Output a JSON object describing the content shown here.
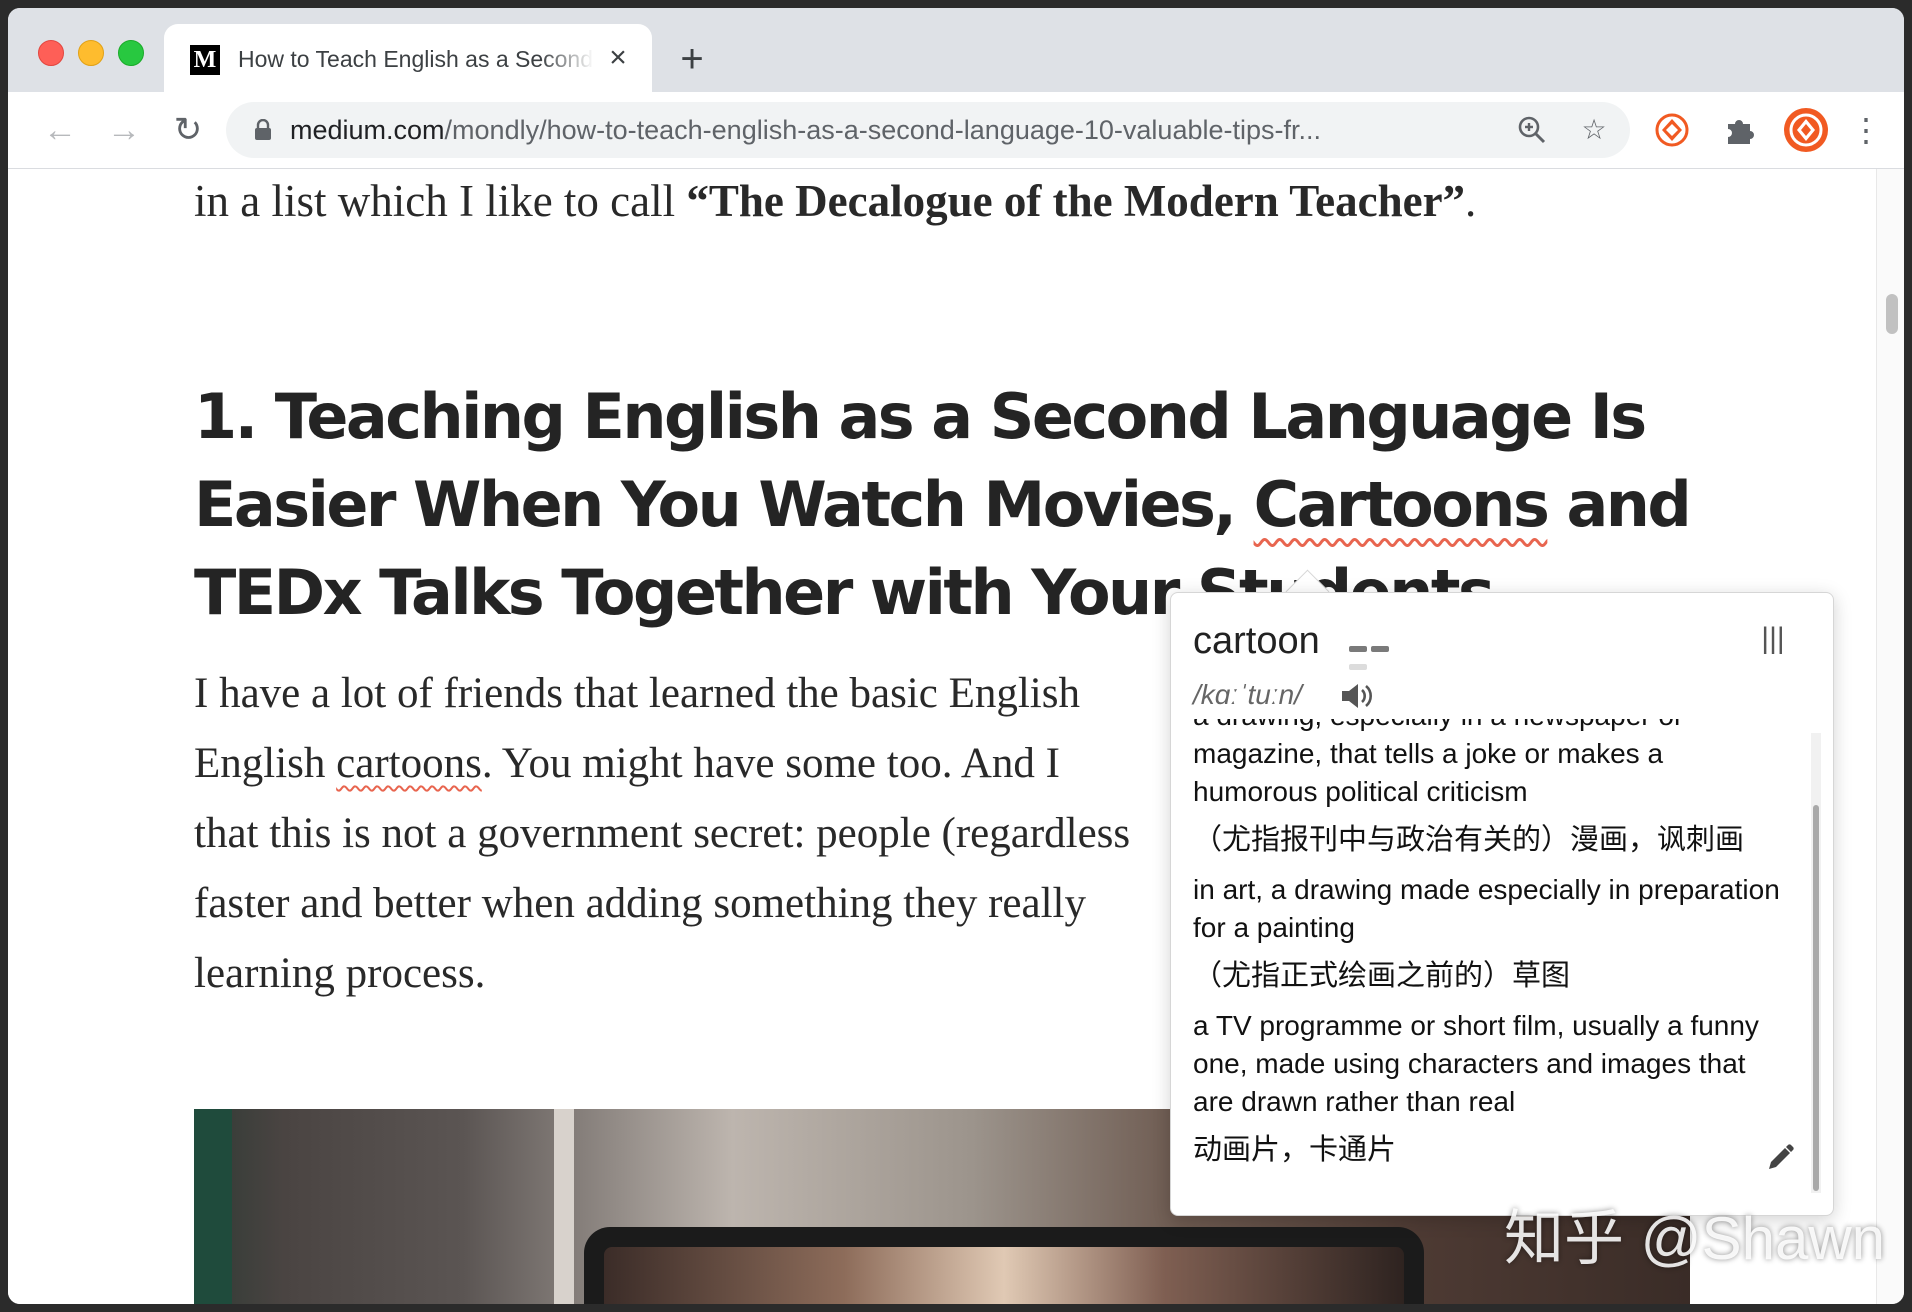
{
  "browser": {
    "tab": {
      "favicon": "M",
      "title": "How to Teach English as a Second Language"
    },
    "new_tab": "+",
    "url_host": "medium.com",
    "url_path": "/mondly/how-to-teach-english-as-a-second-language-10-valuable-tips-fr...",
    "icons": [
      "back-icon",
      "forward-icon",
      "reload-icon",
      "lock-icon",
      "zoom-icon",
      "star-icon",
      "extension-icon",
      "puzzle-icon",
      "profile-icon",
      "menu-icon"
    ]
  },
  "article": {
    "lead_pre": "in a list which I like to call ",
    "lead_bold": "“The Decalogue of the Modern Teacher”",
    "lead_post": ".",
    "heading_line1": "1. Teaching English as a Second Language Is",
    "heading_line2_pre": "Easier When You Watch Movies, ",
    "heading_line2_word": "Cartoons",
    "heading_line2_post": " and",
    "heading_line3": "TEDx Talks Together with Your Students",
    "para_line1": "I have a lot of friends that learned the basic English",
    "para_line2_pre": "English ",
    "para_line2_word": "cartoons",
    "para_line2_post": ". You might have some too. And I",
    "para_line3": "that this is not a government secret: people (regardless",
    "para_line4": "faster and better when adding something they really",
    "para_line5": "learning process."
  },
  "dictionary": {
    "word": "cartoon",
    "phonetic": "/kɑːˈtuːn/",
    "frequency_level": 2,
    "frequency_max": 3,
    "definitions": [
      {
        "en": "a drawing, especially in a newspaper or magazine, that tells a joke or makes a humorous political criticism",
        "zh": "（尤指报刊中与政治有关的）漫画，讽刺画"
      },
      {
        "en": "in art, a drawing made especially in preparation for a painting",
        "zh": "（尤指正式绘画之前的）草图"
      },
      {
        "en": "a TV programme or short film, usually a funny one, made using characters and images that are drawn rather than real",
        "zh": "动画片，卡通片"
      }
    ]
  },
  "watermark": "知乎 @Shawn",
  "colors": {
    "accent_profile": "#f15a22",
    "squiggle": "#e8654f",
    "tab_strip": "#dee1e6"
  }
}
